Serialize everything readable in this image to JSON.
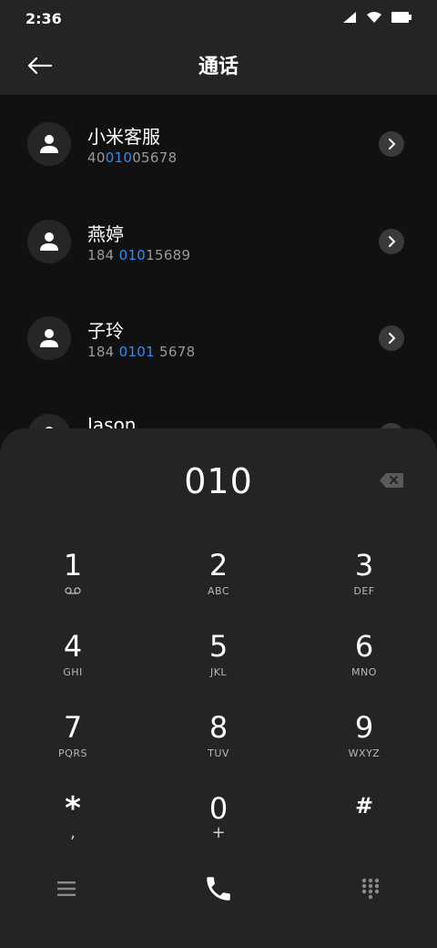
{
  "status_bar": {
    "time": "2:36"
  },
  "header": {
    "title": "通话"
  },
  "contacts": [
    {
      "name": "小米客服",
      "number_pre": "40",
      "number_hl": "010",
      "number_post": "05678"
    },
    {
      "name": "燕婷",
      "number_pre": "184 ",
      "number_hl": "010",
      "number_post": "15689"
    },
    {
      "name": "子玲",
      "number_pre": "184 ",
      "number_hl": "0101",
      "number_post": " 5678"
    },
    {
      "name": "Jason",
      "number_pre": "",
      "number_hl": "",
      "number_post": ""
    }
  ],
  "dialpad": {
    "input": "010",
    "keys": [
      {
        "digit": "1",
        "letters": ""
      },
      {
        "digit": "2",
        "letters": "ABC"
      },
      {
        "digit": "3",
        "letters": "DEF"
      },
      {
        "digit": "4",
        "letters": "GHI"
      },
      {
        "digit": "5",
        "letters": "JKL"
      },
      {
        "digit": "6",
        "letters": "MNO"
      },
      {
        "digit": "7",
        "letters": "PQRS"
      },
      {
        "digit": "8",
        "letters": "TUV"
      },
      {
        "digit": "9",
        "letters": "WXYZ"
      },
      {
        "digit": "*",
        "letters": ","
      },
      {
        "digit": "0",
        "letters": "+"
      },
      {
        "digit": "#",
        "letters": ""
      }
    ]
  },
  "icons": {
    "back": "arrow-left-icon",
    "avatar": "person-icon",
    "detail": "chevron-right-icon",
    "backspace": "backspace-icon",
    "voicemail": "voicemail-icon",
    "menu": "menu-icon",
    "call": "phone-icon",
    "dialpad_toggle": "dialpad-icon"
  },
  "colors": {
    "highlight": "#2f8df3",
    "background": "#111111",
    "panel": "#242424"
  }
}
